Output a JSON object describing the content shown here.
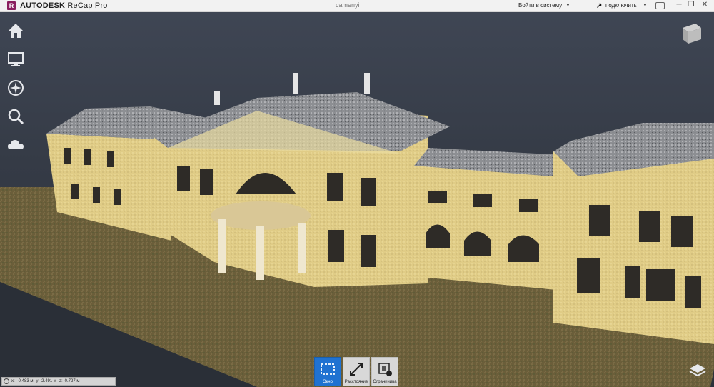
{
  "titlebar": {
    "logo_letter": "R",
    "brand": "AUTODESK",
    "product": "ReCap Pro",
    "document": "camenyi",
    "login_label": "Войти в систему",
    "connect_label": "подключить",
    "icons": [
      "connect-icon",
      "chat-icon",
      "minimize-icon",
      "restore-icon",
      "close-icon"
    ]
  },
  "leftnav": {
    "items": [
      "home-icon",
      "display-icon",
      "navigation-icon",
      "search-icon",
      "cloud-icon"
    ]
  },
  "toolbar": {
    "tools": [
      {
        "label": "Окно",
        "icon": "window-select-icon",
        "active": true
      },
      {
        "label": "Расстояние",
        "icon": "distance-icon",
        "active": false
      },
      {
        "label": "Ограничива",
        "icon": "clip-box-icon",
        "active": false
      }
    ]
  },
  "coords": {
    "x_label": "x:",
    "x_value": "-0.483 м",
    "y_label": "y:",
    "y_value": "2.491 м",
    "z_label": "z:",
    "z_value": "0.727 м"
  },
  "colors": {
    "accent": "#1f72d1",
    "logo": "#8a1e5e",
    "sky": "#3f4654",
    "facade": "#e6d28a"
  }
}
